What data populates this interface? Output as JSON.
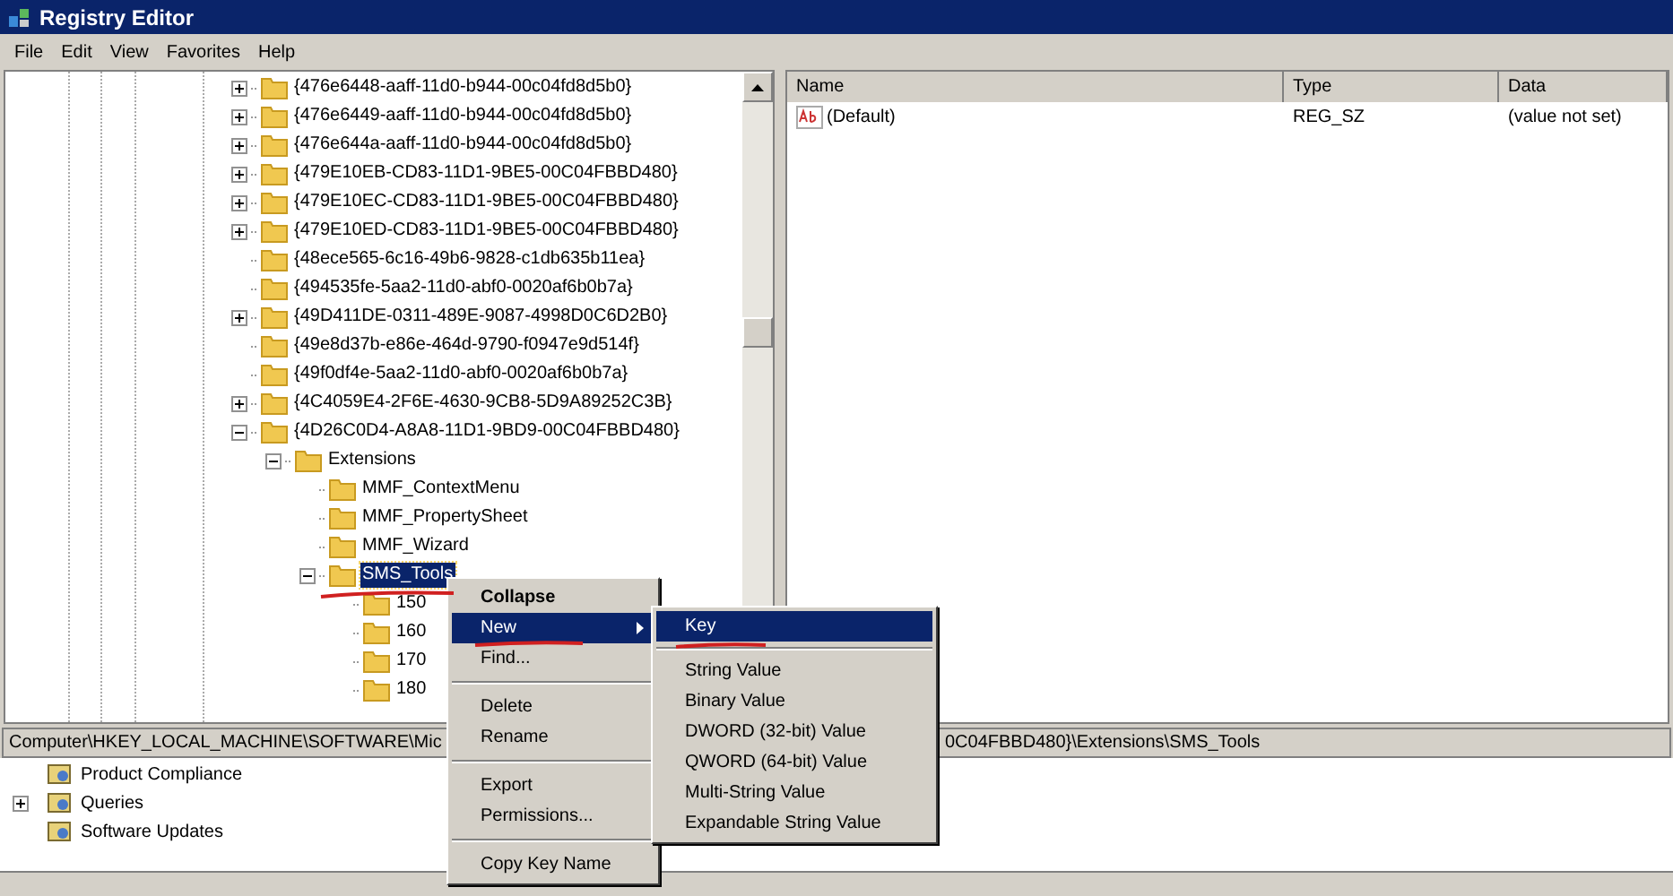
{
  "window": {
    "title": "Registry Editor"
  },
  "menu_bar": [
    "File",
    "Edit",
    "View",
    "Favorites",
    "Help"
  ],
  "tree": [
    {
      "label": "{476e6448-aaff-11d0-b944-00c04fd8d5b0}",
      "expanded": false,
      "selected": false
    },
    {
      "label": "{476e6449-aaff-11d0-b944-00c04fd8d5b0}",
      "expanded": false,
      "selected": false
    },
    {
      "label": "{476e644a-aaff-11d0-b944-00c04fd8d5b0}",
      "expanded": false,
      "selected": false
    },
    {
      "label": "{479E10EB-CD83-11D1-9BE5-00C04FBBD480}",
      "expanded": false,
      "selected": false
    },
    {
      "label": "{479E10EC-CD83-11D1-9BE5-00C04FBBD480}",
      "expanded": false,
      "selected": false
    },
    {
      "label": "{479E10ED-CD83-11D1-9BE5-00C04FBBD480}",
      "expanded": false,
      "selected": false
    },
    {
      "label": "{48ece565-6c16-49b6-9828-c1db635b11ea}",
      "selected": false
    },
    {
      "label": "{494535fe-5aa2-11d0-abf0-0020af6b0b7a}",
      "selected": false
    },
    {
      "label": "{49D411DE-0311-489E-9087-4998D0C6D2B0}",
      "expanded": false,
      "selected": false
    },
    {
      "label": "{49e8d37b-e86e-464d-9790-f0947e9d514f}",
      "selected": false
    },
    {
      "label": "{49f0df4e-5aa2-11d0-abf0-0020af6b0b7a}",
      "selected": false
    },
    {
      "label": "{4C4059E4-2F6E-4630-9CB8-5D9A89252C3B}",
      "expanded": false,
      "selected": false
    },
    {
      "label": "{4D26C0D4-A8A8-11D1-9BD9-00C04FBBD480}",
      "expanded": true,
      "selected": false,
      "children": [
        {
          "label": "Extensions",
          "expanded": true,
          "selected": false,
          "children": [
            {
              "label": "MMF_ContextMenu",
              "selected": false
            },
            {
              "label": "MMF_PropertySheet",
              "selected": false
            },
            {
              "label": "MMF_Wizard",
              "selected": false
            },
            {
              "label": "SMS_Tools",
              "expanded": true,
              "selected": true,
              "children": [
                {
                  "label": "150",
                  "selected": false
                },
                {
                  "label": "160",
                  "selected": false
                },
                {
                  "label": "170",
                  "selected": false
                },
                {
                  "label": "180",
                  "selected": false
                }
              ]
            }
          ]
        }
      ]
    }
  ],
  "values": {
    "columns": [
      "Name",
      "Type",
      "Data"
    ],
    "rows": [
      {
        "name": "(Default)",
        "type": "REG_SZ",
        "data": "(value not set)"
      }
    ]
  },
  "status_bar": {
    "left": "Computer\\HKEY_LOCAL_MACHINE\\SOFTWARE\\Mic",
    "right": "0C04FBBD480}\\Extensions\\SMS_Tools"
  },
  "context_menu": {
    "groups": [
      [
        {
          "label": "Collapse",
          "default": true,
          "selected": false
        },
        {
          "label": "New",
          "default": false,
          "selected": true,
          "submenu": true
        },
        {
          "label": "Find...",
          "default": false,
          "selected": false
        }
      ],
      [
        {
          "label": "Delete",
          "default": false,
          "selected": false
        },
        {
          "label": "Rename",
          "default": false,
          "selected": false
        }
      ],
      [
        {
          "label": "Export",
          "default": false,
          "selected": false
        },
        {
          "label": "Permissions...",
          "default": false,
          "selected": false
        }
      ],
      [
        {
          "label": "Copy Key Name",
          "default": false,
          "selected": false
        }
      ]
    ]
  },
  "submenu": {
    "groups": [
      [
        {
          "label": "Key",
          "selected": true
        }
      ],
      [
        {
          "label": "String Value",
          "selected": false
        },
        {
          "label": "Binary Value",
          "selected": false
        },
        {
          "label": "DWORD (32-bit) Value",
          "selected": false
        },
        {
          "label": "QWORD (64-bit) Value",
          "selected": false
        },
        {
          "label": "Multi-String Value",
          "selected": false
        },
        {
          "label": "Expandable String Value",
          "selected": false
        }
      ]
    ]
  },
  "background_tree": [
    {
      "label": "Product Compliance"
    },
    {
      "label": "Queries",
      "expanded": false
    },
    {
      "label": "Software Updates"
    }
  ]
}
